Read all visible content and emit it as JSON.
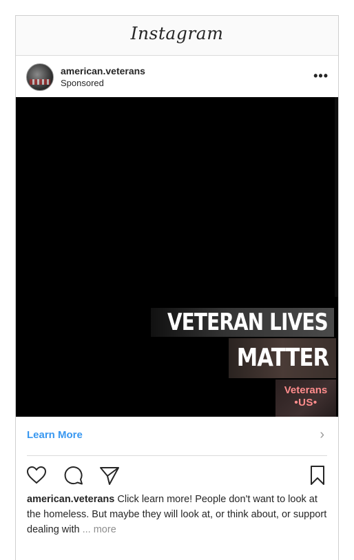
{
  "app": {
    "title": "Instagram"
  },
  "post": {
    "username": "american.veterans",
    "sponsored": "Sponsored",
    "more_glyph": "•••",
    "media": {
      "line1": "VETERAN LIVES",
      "line2": "MATTER",
      "badge_line1": "Veterans",
      "badge_line2": "•US•"
    },
    "cta": {
      "label": "Learn More",
      "chevron": "›"
    },
    "actions": {
      "icons": [
        "heart-icon",
        "comment-icon",
        "share-icon",
        "bookmark-icon"
      ]
    },
    "caption": {
      "username": "american.veterans",
      "text": " Click learn more! People don't want to look at the homeless. But maybe they will look at, or think about, or support dealing with ",
      "more": "... more"
    }
  },
  "colors": {
    "link": "#3897f0",
    "text": "#262626",
    "muted": "#8e8e8e",
    "badge_text": "#ff8c8c"
  }
}
